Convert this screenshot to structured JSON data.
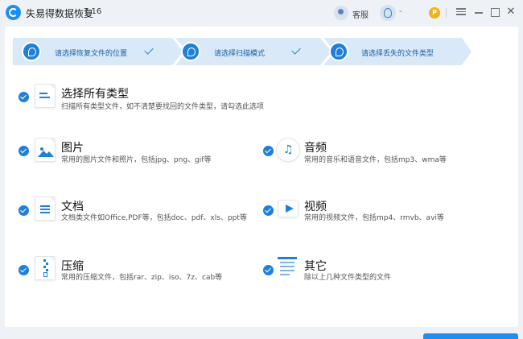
{
  "app": {
    "title": "失易得数据恢复",
    "version": "7.16",
    "service_label": "客服",
    "user_text": "-"
  },
  "steps": [
    {
      "label": "请选择恢复文件的位置",
      "done": true
    },
    {
      "label": "请选择扫描模式",
      "done": true
    },
    {
      "label": "请选择丢失的文件类型",
      "done": false
    }
  ],
  "options": {
    "all": {
      "title": "选择所有类型",
      "desc": "扫描所有类型文件，如不清楚要找回的文件类型，请勾选此选项",
      "checked": true
    },
    "image": {
      "title": "图片",
      "desc": "常用的图片文件和照片，包括jpg、png、gif等",
      "checked": true
    },
    "audio": {
      "title": "音频",
      "desc": "常用的音乐和语音文件，包括mp3、wma等",
      "checked": true
    },
    "document": {
      "title": "文档",
      "desc": "文档类文件如Office,PDF等，包括doc、pdf、xls、ppt等",
      "checked": true
    },
    "video": {
      "title": "视频",
      "desc": "常用的视频文件，包括mp4、rmvb、avi等",
      "checked": true
    },
    "archive": {
      "title": "压缩",
      "desc": "常用的压缩文件，包括rar、zip、iso、7z、cab等",
      "checked": true
    },
    "other": {
      "title": "其它",
      "desc": "除以上几种文件类型的文件",
      "checked": true
    }
  },
  "colors": {
    "accent": "#1e80d8",
    "step_bg": "#d9e9f8",
    "vip": "#f3b21b"
  },
  "icons": {
    "window": [
      "menu-icon",
      "minimize-icon",
      "maximize-icon",
      "close-icon"
    ]
  }
}
